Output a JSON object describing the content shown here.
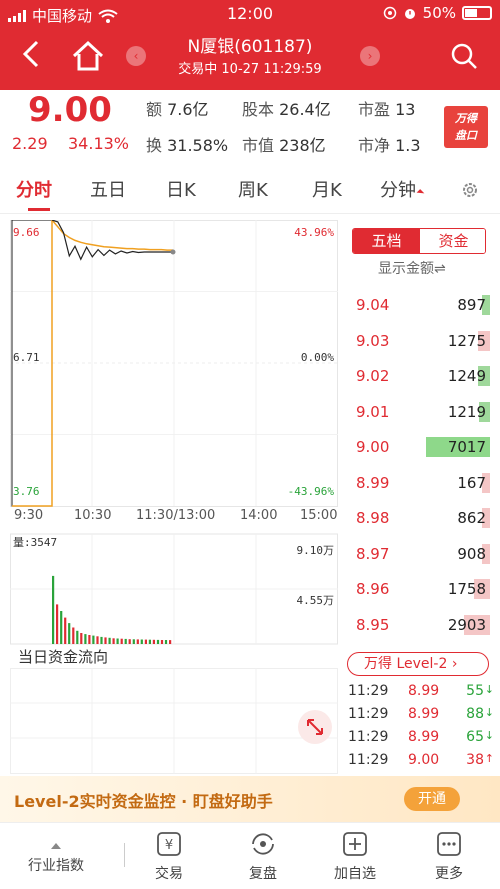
{
  "status": {
    "carrier": "中国移动",
    "time": "12:00",
    "battery": "50%"
  },
  "nav": {
    "title": "N厦银(601187)",
    "subtitle": "交易中 10-27 11:29:59"
  },
  "quote": {
    "price": "9.00",
    "change": "2.29",
    "change_pct": "34.13%",
    "stats": [
      {
        "key": "额",
        "value": "7.6亿"
      },
      {
        "key": "股本",
        "value": "26.4亿"
      },
      {
        "key": "市盈",
        "value": "13"
      },
      {
        "key": "换",
        "value": "31.58%"
      },
      {
        "key": "市值",
        "value": "238亿"
      },
      {
        "key": "市净",
        "value": "1.3"
      }
    ],
    "badge_line1": "万得",
    "badge_line2": "盘口"
  },
  "tabs": [
    "分时",
    "五日",
    "日K",
    "周K",
    "月K",
    "分钟"
  ],
  "chart": {
    "price_top": "9.66",
    "price_mid": "6.71",
    "price_bottom": "3.76",
    "pct_top": "43.96%",
    "pct_mid": "0.00%",
    "pct_bottom": "-43.96%",
    "times": [
      "9:30",
      "10:30",
      "11:30/13:00",
      "14:00",
      "15:00"
    ],
    "volume_label": "量:3547",
    "vol_top": "9.10万",
    "vol_mid": "4.55万",
    "flow_title": "当日资金流向"
  },
  "chart_data": {
    "type": "line",
    "title": "",
    "xlabel": "",
    "ylabel": "",
    "ylim": [
      3.76,
      9.66
    ],
    "price_series": [
      9.66,
      9.62,
      9.4,
      8.92,
      9.12,
      8.85,
      9.1,
      8.9,
      9.05,
      8.93,
      9.04,
      8.96,
      9.02,
      8.98,
      9.01,
      8.99,
      9.0,
      9.0,
      9.0,
      9.0,
      9.0,
      9.0
    ],
    "avg_series": [
      9.66,
      9.52,
      9.38,
      9.3,
      9.24,
      9.2,
      9.17,
      9.15,
      9.13,
      9.11,
      9.1,
      9.09,
      9.08,
      9.07,
      9.07,
      9.06,
      9.06,
      9.05,
      9.05,
      9.05,
      9.04,
      9.04
    ],
    "preopen": {
      "high": 9.66,
      "low": 3.76
    },
    "volume_max": 91000,
    "volume": [
      62000,
      36000,
      30000,
      24000,
      19000,
      15000,
      12000,
      10000,
      9000,
      8200,
      7600,
      7000,
      6500,
      6000,
      5600,
      5200,
      5000,
      4800,
      4600,
      4400,
      4300,
      4200,
      4100,
      4000,
      3900,
      3800,
      3700,
      3600,
      3600,
      3547
    ]
  },
  "book": {
    "seg_left": "五档",
    "seg_right": "资金",
    "show_amount": "显示金额⇌",
    "rows": [
      {
        "price": "9.04",
        "vol": "897",
        "bar": 0.13,
        "color": "#9fd89b"
      },
      {
        "price": "9.03",
        "vol": "1275",
        "bar": 0.18,
        "color": "#f4c6c6"
      },
      {
        "price": "9.02",
        "vol": "1249",
        "bar": 0.18,
        "color": "#9fd89b"
      },
      {
        "price": "9.01",
        "vol": "1219",
        "bar": 0.17,
        "color": "#9fd89b"
      },
      {
        "price": "9.00",
        "vol": "7017",
        "bar": 1.0,
        "color": "#8ed88a"
      },
      {
        "price": "8.99",
        "vol": "167",
        "bar": 0.03,
        "color": "#f4c6c6"
      },
      {
        "price": "8.98",
        "vol": "862",
        "bar": 0.12,
        "color": "#f4c6c6"
      },
      {
        "price": "8.97",
        "vol": "908",
        "bar": 0.13,
        "color": "#f4c6c6"
      },
      {
        "price": "8.96",
        "vol": "1758",
        "bar": 0.25,
        "color": "#f4c6c6"
      },
      {
        "price": "8.95",
        "vol": "2903",
        "bar": 0.41,
        "color": "#f4c6c6"
      }
    ],
    "level2_label": "万得 Level-2 ›",
    "trades": [
      {
        "time": "11:29",
        "price": "8.99",
        "vol": "55",
        "arrow": "↓",
        "color": "#2aa33a"
      },
      {
        "time": "11:29",
        "price": "8.99",
        "vol": "88",
        "arrow": "↓",
        "color": "#2aa33a"
      },
      {
        "time": "11:29",
        "price": "8.99",
        "vol": "65",
        "arrow": "↓",
        "color": "#2aa33a"
      },
      {
        "time": "11:29",
        "price": "9.00",
        "vol": "38",
        "arrow": "↑",
        "color": "#e02b32"
      }
    ]
  },
  "banner": {
    "text": "Level-2实时资金监控 · 盯盘好助手",
    "button": "开通"
  },
  "bottom": {
    "industry": "行业指数",
    "items": [
      "交易",
      "复盘",
      "加自选",
      "更多"
    ]
  }
}
